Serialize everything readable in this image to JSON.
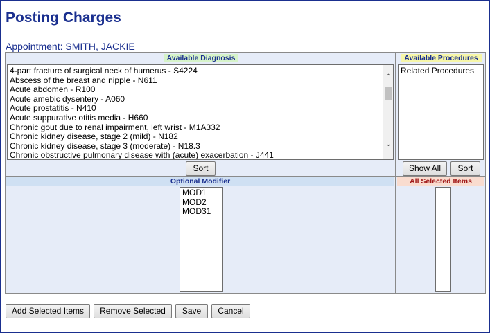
{
  "page": {
    "title": "Posting Charges"
  },
  "appointment": {
    "label": "Appointment:",
    "patient": "SMITH, JACKIE"
  },
  "diagnosis": {
    "header": "Available Diagnosis",
    "items": [
      "4-part fracture of surgical neck of humerus - S4224",
      "Abscess of the breast and nipple - N611",
      "Acute abdomen - R100",
      "Acute amebic dysentery - A060",
      "Acute prostatitis - N410",
      "Acute suppurative otitis media - H660",
      "Chronic gout due to renal impairment, left wrist - M1A332",
      "Chronic kidney disease, stage 2 (mild) - N182",
      "Chronic kidney disease, stage 3 (moderate) - N18.3",
      "Chronic obstructive pulmonary disease with (acute) exacerbation - J441"
    ],
    "sort_label": "Sort"
  },
  "procedures": {
    "header": "Available Procedures",
    "items": [
      "Related Procedures"
    ],
    "show_all_label": "Show All",
    "sort_label": "Sort"
  },
  "modifier": {
    "header": "Optional Modifier",
    "items": [
      "MOD1",
      "MOD2",
      "MOD31"
    ]
  },
  "selected": {
    "header": "All Selected Items",
    "items": []
  },
  "footer": {
    "add_label": "Add Selected Items",
    "remove_label": "Remove Selected",
    "save_label": "Save",
    "cancel_label": "Cancel"
  }
}
